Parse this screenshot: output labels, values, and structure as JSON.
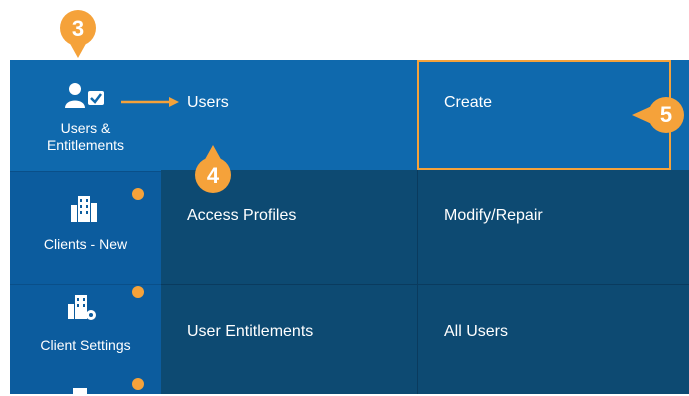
{
  "sidebar": {
    "items": [
      {
        "label_line1": "Users &",
        "label_line2": "Entitlements",
        "icon": "user-check-icon",
        "active": true
      },
      {
        "label_line1": "Clients - New",
        "icon": "building-icon"
      },
      {
        "label_line1": "Client Settings",
        "icon": "building-gear-icon"
      }
    ]
  },
  "menu": {
    "col1": [
      "Users",
      "Access Profiles",
      "User Entitlements"
    ],
    "col2": [
      "Create",
      "Modify/Repair",
      "All Users"
    ]
  },
  "callouts": [
    "3",
    "4",
    "5"
  ],
  "colors": {
    "sidebar": "#0c5c9e",
    "active": "#0f69ad",
    "panel": "#0d4a72",
    "accent": "#f5a23a"
  }
}
